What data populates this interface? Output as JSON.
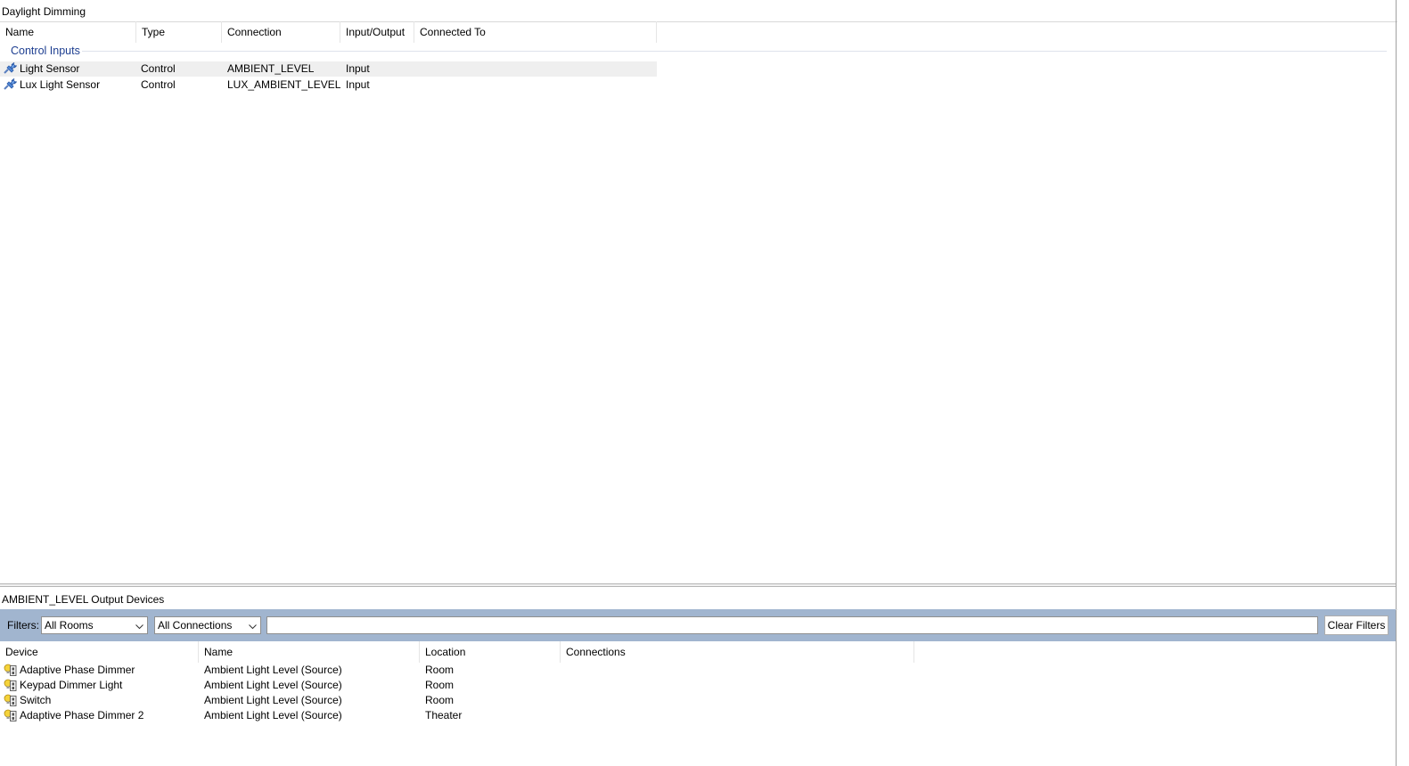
{
  "top_pane": {
    "title": "Daylight Dimming",
    "columns": [
      "Name",
      "Type",
      "Connection",
      "Input/Output",
      "Connected To"
    ],
    "group_label": "Control Inputs",
    "rows": [
      {
        "name": "Light Sensor",
        "type": "Control",
        "connection": "AMBIENT_LEVEL",
        "io": "Input",
        "connected_to": "",
        "icon": "control-connector-icon",
        "selected": true
      },
      {
        "name": "Lux Light Sensor",
        "type": "Control",
        "connection": "LUX_AMBIENT_LEVEL",
        "io": "Input",
        "connected_to": "",
        "icon": "control-connector-icon",
        "selected": false
      }
    ]
  },
  "bottom_pane": {
    "title": "AMBIENT_LEVEL Output Devices",
    "filters": {
      "label": "Filters:",
      "rooms_value": "All Rooms",
      "connections_value": "All Connections",
      "search_value": "",
      "clear_label": "Clear Filters"
    },
    "columns": [
      "Device",
      "Name",
      "Location",
      "Connections"
    ],
    "rows": [
      {
        "device": "Adaptive Phase Dimmer",
        "name": "Ambient Light Level (Source)",
        "location": "Room",
        "connections": "",
        "icon": "dimmer-device-icon"
      },
      {
        "device": "Keypad Dimmer Light",
        "name": "Ambient Light Level (Source)",
        "location": "Room",
        "connections": "",
        "icon": "dimmer-device-icon"
      },
      {
        "device": "Switch",
        "name": "Ambient Light Level (Source)",
        "location": "Room",
        "connections": "",
        "icon": "dimmer-device-icon"
      },
      {
        "device": "Adaptive Phase Dimmer 2",
        "name": "Ambient Light Level (Source)",
        "location": "Theater",
        "connections": "",
        "icon": "dimmer-device-icon"
      }
    ]
  },
  "colors": {
    "group_label": "#1e3f91",
    "filter_bar": "#a1b5cf",
    "selected_row": "#efefef"
  }
}
